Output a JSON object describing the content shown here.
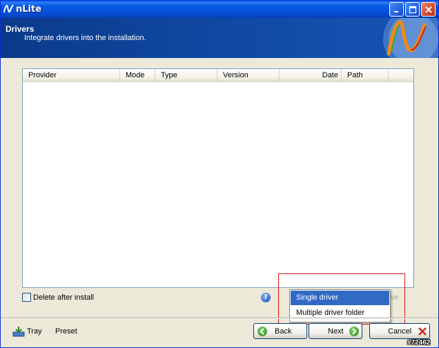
{
  "window": {
    "title": "nLite"
  },
  "header": {
    "title": "Drivers",
    "subtitle": "Integrate drivers into the installation."
  },
  "driver_list": {
    "columns": [
      "Provider",
      "Mode",
      "Type",
      "Version",
      "Date",
      "Path"
    ],
    "rows": []
  },
  "options": {
    "delete_after_install_label": "Delete after install",
    "delete_after_install_checked": false
  },
  "insert_button_partial": "ve",
  "insert_menu": {
    "items": [
      "Single driver",
      "Multiple driver folder"
    ],
    "selected": "Single driver"
  },
  "footer": {
    "tray_label": "Tray",
    "preset_label": "Preset",
    "back_label": "Back",
    "next_label": "Next",
    "cancel_label": "Cancel"
  },
  "watermark": "#72462",
  "icons": {
    "title_logo": "nlite-logo-icon",
    "minimize": "minimize-icon",
    "maximize": "maximize-icon",
    "close": "close-icon",
    "help": "help-icon",
    "tray": "tray-icon",
    "back": "back-arrow-icon",
    "next": "next-arrow-icon",
    "cancel": "cancel-x-icon"
  },
  "colors": {
    "titlebar": "#0A5FE9",
    "header": "#114BA7",
    "menu_selected": "#316AC5",
    "highlight_rect": "#E01010"
  }
}
